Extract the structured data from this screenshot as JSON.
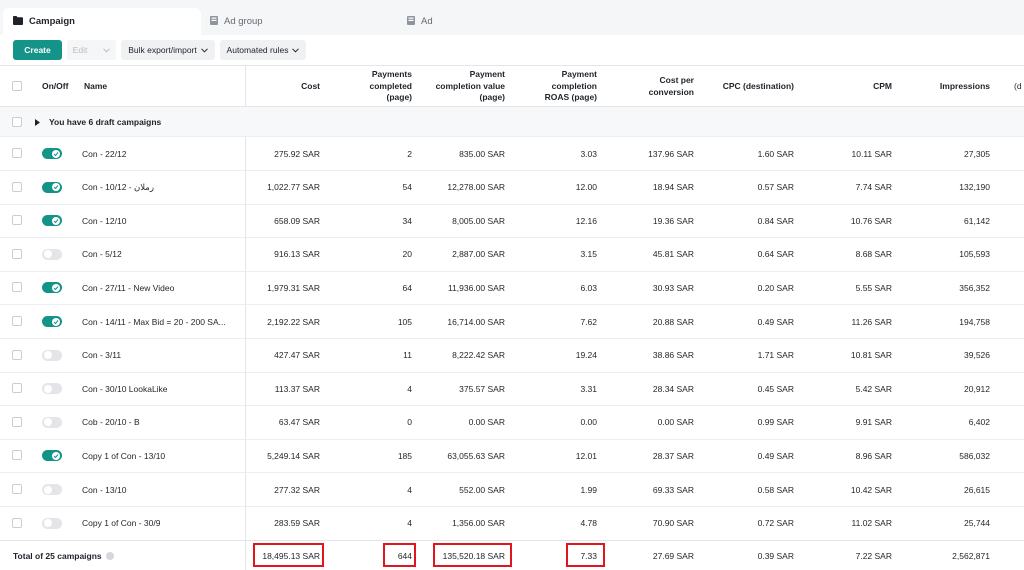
{
  "tabs": [
    {
      "label": "Campaign",
      "active": true
    },
    {
      "label": "Ad group",
      "active": false
    },
    {
      "label": "Ad",
      "active": false
    }
  ],
  "toolbar": {
    "create": "Create",
    "edit": "Edit",
    "bulk": "Bulk export/import",
    "rules": "Automated rules"
  },
  "colors": {
    "accent": "#149488",
    "highlight": "#e0161e"
  },
  "columns": {
    "onoff": "On/Off",
    "name": "Name",
    "cost": "Cost",
    "payments": "Payments completed (page)",
    "value": "Payment completion value (page)",
    "roas": "Payment completion ROAS (page)",
    "cpc_conv": "Cost per conversion",
    "cpc_dest": "CPC (destination)",
    "cpm": "CPM",
    "impressions": "Impressions",
    "overflow": "(d"
  },
  "draft_label": "You have 6 draft campaigns",
  "rows": [
    {
      "on": true,
      "name": "Con - 22/12",
      "cost": "275.92 SAR",
      "payments": "2",
      "value": "835.00 SAR",
      "roas": "3.03",
      "cpconv": "137.96 SAR",
      "cpc": "1.60 SAR",
      "cpm": "10.11 SAR",
      "impr": "27,305"
    },
    {
      "on": true,
      "name": "Con - 10/12 - رملان",
      "cost": "1,022.77 SAR",
      "payments": "54",
      "value": "12,278.00 SAR",
      "roas": "12.00",
      "cpconv": "18.94 SAR",
      "cpc": "0.57 SAR",
      "cpm": "7.74 SAR",
      "impr": "132,190"
    },
    {
      "on": true,
      "name": "Con - 12/10",
      "cost": "658.09 SAR",
      "payments": "34",
      "value": "8,005.00 SAR",
      "roas": "12.16",
      "cpconv": "19.36 SAR",
      "cpc": "0.84 SAR",
      "cpm": "10.76 SAR",
      "impr": "61,142"
    },
    {
      "on": false,
      "name": "Con - 5/12",
      "cost": "916.13 SAR",
      "payments": "20",
      "value": "2,887.00 SAR",
      "roas": "3.15",
      "cpconv": "45.81 SAR",
      "cpc": "0.64 SAR",
      "cpm": "8.68 SAR",
      "impr": "105,593"
    },
    {
      "on": true,
      "name": "Con - 27/11 - New Video",
      "cost": "1,979.31 SAR",
      "payments": "64",
      "value": "11,936.00 SAR",
      "roas": "6.03",
      "cpconv": "30.93 SAR",
      "cpc": "0.20 SAR",
      "cpm": "5.55 SAR",
      "impr": "356,352"
    },
    {
      "on": true,
      "name": "Con - 14/11 - Max Bid = 20 - 200 SA...",
      "cost": "2,192.22 SAR",
      "payments": "105",
      "value": "16,714.00 SAR",
      "roas": "7.62",
      "cpconv": "20.88 SAR",
      "cpc": "0.49 SAR",
      "cpm": "11.26 SAR",
      "impr": "194,758"
    },
    {
      "on": false,
      "name": "Con - 3/11",
      "cost": "427.47 SAR",
      "payments": "11",
      "value": "8,222.42 SAR",
      "roas": "19.24",
      "cpconv": "38.86 SAR",
      "cpc": "1.71 SAR",
      "cpm": "10.81 SAR",
      "impr": "39,526"
    },
    {
      "on": false,
      "name": "Con - 30/10 LookaLike",
      "cost": "113.37 SAR",
      "payments": "4",
      "value": "375.57 SAR",
      "roas": "3.31",
      "cpconv": "28.34 SAR",
      "cpc": "0.45 SAR",
      "cpm": "5.42 SAR",
      "impr": "20,912"
    },
    {
      "on": false,
      "name": "Cob - 20/10 - B",
      "cost": "63.47 SAR",
      "payments": "0",
      "value": "0.00 SAR",
      "roas": "0.00",
      "cpconv": "0.00 SAR",
      "cpc": "0.99 SAR",
      "cpm": "9.91 SAR",
      "impr": "6,402"
    },
    {
      "on": true,
      "name": "Copy 1 of Con - 13/10",
      "cost": "5,249.14 SAR",
      "payments": "185",
      "value": "63,055.63 SAR",
      "roas": "12.01",
      "cpconv": "28.37 SAR",
      "cpc": "0.49 SAR",
      "cpm": "8.96 SAR",
      "impr": "586,032"
    },
    {
      "on": false,
      "name": "Con - 13/10",
      "cost": "277.32 SAR",
      "payments": "4",
      "value": "552.00 SAR",
      "roas": "1.99",
      "cpconv": "69.33 SAR",
      "cpc": "0.58 SAR",
      "cpm": "10.42 SAR",
      "impr": "26,615"
    },
    {
      "on": false,
      "name": "Copy 1 of Con - 30/9",
      "cost": "283.59 SAR",
      "payments": "4",
      "value": "1,356.00 SAR",
      "roas": "4.78",
      "cpconv": "70.90 SAR",
      "cpc": "0.72 SAR",
      "cpm": "11.02 SAR",
      "impr": "25,744"
    }
  ],
  "total": {
    "label": "Total of 25 campaigns",
    "cost": "18,495.13 SAR",
    "payments": "644",
    "value": "135,520.18 SAR",
    "roas": "7.33",
    "cpconv": "27.69 SAR",
    "cpc": "0.39 SAR",
    "cpm": "7.22 SAR",
    "impr": "2,562,871"
  }
}
